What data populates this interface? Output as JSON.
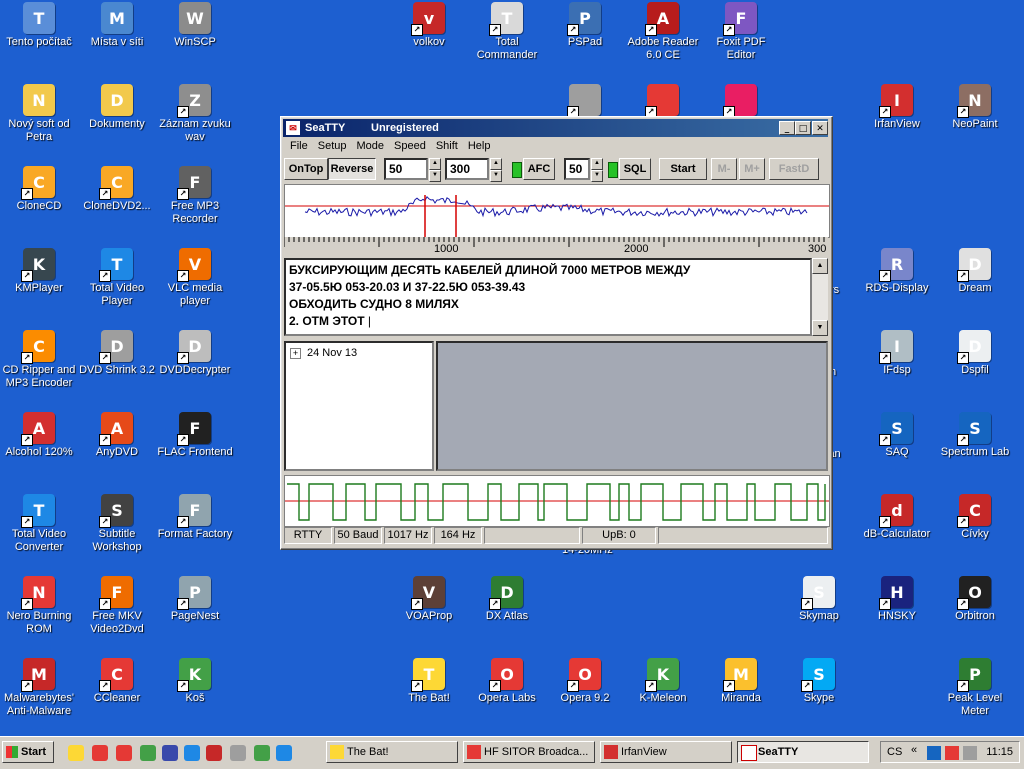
{
  "desktop": {
    "icons": [
      {
        "label": "Tento počítač",
        "icon": "computer-icon",
        "color": "#5a8ed8"
      },
      {
        "label": "Místa v síti",
        "icon": "network-icon",
        "color": "#4a88d0"
      },
      {
        "label": "WinSCP",
        "icon": "winscp-icon",
        "color": "#8b8b8b"
      },
      {
        "label": "volkov",
        "icon": "volkov-icon",
        "color": "#c62828"
      },
      {
        "label": "Total Commander",
        "icon": "total-commander-icon",
        "color": "#d9d9d9"
      },
      {
        "label": "PSPad",
        "icon": "pspad-icon",
        "color": "#3b6fb3"
      },
      {
        "label": "Adobe Reader 6.0 CE",
        "icon": "adobe-reader-icon",
        "color": "#b71c1c"
      },
      {
        "label": "Foxit PDF Editor",
        "icon": "foxit-icon",
        "color": "#7e57c2"
      },
      {
        "label": "Nový soft od Petra",
        "icon": "folder-icon",
        "color": "#f2c94c"
      },
      {
        "label": "Dokumenty",
        "icon": "documents-folder-icon",
        "color": "#f2c94c"
      },
      {
        "label": "Záznam zvuku wav",
        "icon": "speaker-icon",
        "color": "#8e8e8e"
      },
      {
        "label": "",
        "icon": "paint-app-icon",
        "color": "#9e9e9e"
      },
      {
        "label": "",
        "icon": "red-circle-app-icon",
        "color": "#e53935"
      },
      {
        "label": "",
        "icon": "film-app-icon",
        "color": "#e91e63"
      },
      {
        "label": "IrfanView",
        "icon": "irfanview-icon",
        "color": "#d32f2f"
      },
      {
        "label": "NeoPaint",
        "icon": "neopaint-icon",
        "color": "#8d6e63"
      },
      {
        "label": "CloneCD",
        "icon": "clonecd-icon",
        "color": "#f9a825"
      },
      {
        "label": "CloneDVD2...",
        "icon": "clonedvd-icon",
        "color": "#f9a825"
      },
      {
        "label": "Free MP3 Recorder",
        "icon": "mp3-recorder-icon",
        "color": "#616161"
      },
      {
        "label": "KMPlayer",
        "icon": "kmplayer-icon",
        "color": "#37474f"
      },
      {
        "label": "Total Video Player",
        "icon": "video-player-icon",
        "color": "#1e88e5"
      },
      {
        "label": "VLC media player",
        "icon": "vlc-icon",
        "color": "#ef6c00"
      },
      {
        "label": "RDS-Display",
        "icon": "rds-display-icon",
        "color": "#7986cb"
      },
      {
        "label": "Dream",
        "icon": "dream-icon",
        "color": "#e0e0e0"
      },
      {
        "label": "CD Ripper and MP3 Encoder",
        "icon": "cd-ripper-icon",
        "color": "#fb8c00"
      },
      {
        "label": "DVD Shrink 3.2",
        "icon": "dvd-shrink-icon",
        "color": "#9e9e9e"
      },
      {
        "label": "DVDDecrypter",
        "icon": "dvd-decrypter-icon",
        "color": "#bdbdbd"
      },
      {
        "label": "IFdsp",
        "icon": "ifdsp-icon",
        "color": "#b0bec5"
      },
      {
        "label": "Dspfil",
        "icon": "dspfil-icon",
        "color": "#eceff1"
      },
      {
        "label": "Alcohol 120%",
        "icon": "alcohol-icon",
        "color": "#d32f2f"
      },
      {
        "label": "AnyDVD",
        "icon": "anydvd-icon",
        "color": "#e64a19"
      },
      {
        "label": "FLAC Frontend",
        "icon": "flac-icon",
        "color": "#212121"
      },
      {
        "label": "SAQ",
        "icon": "saq-icon",
        "color": "#1565c0"
      },
      {
        "label": "Spectrum Lab",
        "icon": "spectrum-lab-icon",
        "color": "#1565c0"
      },
      {
        "label": "Total Video Converter",
        "icon": "video-converter-icon",
        "color": "#1e88e5"
      },
      {
        "label": "Subtitle Workshop",
        "icon": "subtitle-workshop-icon",
        "color": "#424242"
      },
      {
        "label": "Format Factory",
        "icon": "format-factory-icon",
        "color": "#90a4ae"
      },
      {
        "label": "dB-Calculator",
        "icon": "db-calculator-icon",
        "color": "#c62828"
      },
      {
        "label": "Cívky",
        "icon": "coils-icon",
        "color": "#c62828"
      },
      {
        "label": "Nero Burning ROM",
        "icon": "nero-icon",
        "color": "#e53935"
      },
      {
        "label": "Free MKV Video2Dvd",
        "icon": "mkv-icon",
        "color": "#ef6c00"
      },
      {
        "label": "PageNest",
        "icon": "pagenest-icon",
        "color": "#90a4ae"
      },
      {
        "label": "VOAProp",
        "icon": "voaprop-icon",
        "color": "#5d4037"
      },
      {
        "label": "DX Atlas",
        "icon": "dx-atlas-icon",
        "color": "#2e7d32"
      },
      {
        "label": "Skymap",
        "icon": "skymap-icon",
        "color": "#eceff1"
      },
      {
        "label": "HNSKY",
        "icon": "hnsky-icon",
        "color": "#1a237e"
      },
      {
        "label": "Orbitron",
        "icon": "orbitron-icon",
        "color": "#212121"
      },
      {
        "label": "Malwarebytes' Anti-Malware",
        "icon": "malwarebytes-icon",
        "color": "#c62828"
      },
      {
        "label": "CCleaner",
        "icon": "ccleaner-icon",
        "color": "#e53935"
      },
      {
        "label": "Koš",
        "icon": "recycle-bin-icon",
        "color": "#43a047"
      },
      {
        "label": "The Bat!",
        "icon": "the-bat-icon",
        "color": "#fdd835"
      },
      {
        "label": "Opera Labs",
        "icon": "opera-labs-icon",
        "color": "#e53935"
      },
      {
        "label": "Opera 9.2",
        "icon": "opera-icon",
        "color": "#e53935"
      },
      {
        "label": "K-Meleon",
        "icon": "k-meleon-icon",
        "color": "#43a047"
      },
      {
        "label": "Miranda",
        "icon": "miranda-icon",
        "color": "#fbc02d"
      },
      {
        "label": "Skype",
        "icon": "skype-icon",
        "color": "#03a9f4"
      },
      {
        "label": "Peak Level Meter",
        "icon": "peak-meter-icon",
        "color": "#2e7d32"
      }
    ],
    "partial_labels": {
      "p1": "n",
      "p2": "rs",
      "p3": "ian",
      "p4": "14-20MHz"
    }
  },
  "window": {
    "app_name": "SeaTTY",
    "status_title": "Unregistered",
    "menu": [
      "File",
      "Setup",
      "Mode",
      "Speed",
      "Shift",
      "Help"
    ],
    "toolbar": {
      "ontop": "OnTop",
      "reverse": "Reverse",
      "value1": "50",
      "value2": "300",
      "afc": "AFC",
      "value3": "50",
      "sql": "SQL",
      "start": "Start",
      "mminus": "M-",
      "mplus": "M+",
      "fastd": "FastD"
    },
    "ruler_labels": [
      "1000",
      "2000",
      "300"
    ],
    "received_text": [
      "БУКСИРУЮЩИМ ДЕСЯТЬ КАБЕЛЕЙ ДЛИНОЙ 7000 МЕТРОВ МЕЖДУ",
      "37-05.5Ю 053-20.03 И 37-22.5Ю 053-39.43",
      "ОБХОДИТЬ СУДНО 8 МИЛЯХ",
      "2. ОТМ ЭТОТ"
    ],
    "tree_date": "24 Nov 13",
    "statusbar": [
      "RTTY",
      "50 Baud",
      "1017 Hz",
      "164 Hz",
      "",
      "UpB: 0",
      ""
    ],
    "colors": {
      "spectrum_trace": "#1a1aa8",
      "marker": "#d40000",
      "scope_trace": "#1d7a1d"
    }
  },
  "taskbar": {
    "start": "Start",
    "tasks": [
      {
        "label": "The Bat!",
        "icon": "the-bat-icon"
      },
      {
        "label": "HF SITOR Broadca...",
        "icon": "opera-icon"
      },
      {
        "label": "IrfanView",
        "icon": "irfanview-icon"
      },
      {
        "label": "SeaTTY",
        "icon": "seatty-icon",
        "active": true
      }
    ],
    "lang": "CS",
    "clock": "11:15"
  }
}
